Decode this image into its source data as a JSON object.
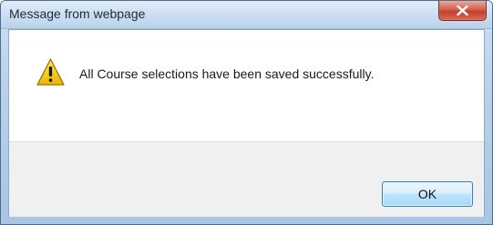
{
  "dialog": {
    "title": "Message from webpage",
    "message": "All Course selections have been saved successfully.",
    "icon": "warning-icon",
    "close_icon": "close-icon",
    "ok_label": "OK"
  },
  "colors": {
    "close_button": "#c84a37",
    "ok_border": "#3c7fb1",
    "footer": "#f0f0f0",
    "warning_yellow": "#f5c400"
  }
}
